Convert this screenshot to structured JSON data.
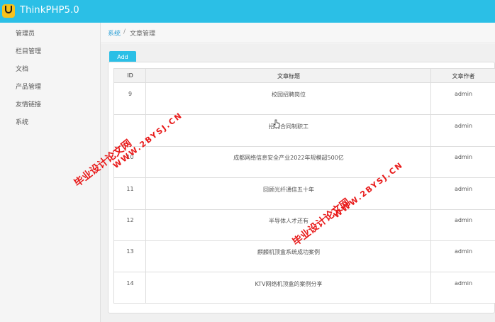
{
  "header": {
    "app_title": "ThinkPHP5.0"
  },
  "sidebar": {
    "items": [
      {
        "label": "管理员"
      },
      {
        "label": "栏目管理"
      },
      {
        "label": "文档"
      },
      {
        "label": "产品管理"
      },
      {
        "label": "友情链接"
      },
      {
        "label": "系统"
      }
    ]
  },
  "breadcrumb": {
    "parent": "系统",
    "separator": "/",
    "current": "文章管理"
  },
  "toolbar": {
    "add_label": "Add"
  },
  "table": {
    "columns": [
      "ID",
      "文章标题",
      "文章作者"
    ],
    "rows": [
      {
        "id": "9",
        "title": "校园招聘岗位",
        "author": "admin"
      },
      {
        "id": "",
        "title": "招聘合同制职工",
        "author": "admin"
      },
      {
        "id": "10",
        "title": "成都网络信息安全产业2022年规模超500亿",
        "author": "admin"
      },
      {
        "id": "11",
        "title": "回顾光纤通信五十年",
        "author": "admin"
      },
      {
        "id": "12",
        "title": "半导体人才还有",
        "author": "admin"
      },
      {
        "id": "13",
        "title": "麒麟机顶盒系统成功案例",
        "author": "admin"
      },
      {
        "id": "14",
        "title": "KTV网络机顶盒的案例分享",
        "author": "admin"
      }
    ]
  },
  "watermark": {
    "cn": "毕业设计论文网",
    "url": "WWW.2BYSJ.CN"
  },
  "colors": {
    "accent": "#2bbfe6",
    "logo": "#f6c21c",
    "watermark": "#e81919",
    "link": "#2a9fd6"
  }
}
